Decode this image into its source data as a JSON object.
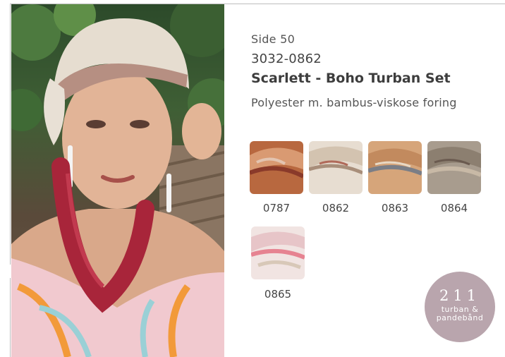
{
  "page": {
    "side": "Side 50",
    "article_code": "3032-0862",
    "title": "Scarlett - Boho Turban Set",
    "material": "Polyester m. bambus-viskose foring"
  },
  "swatches": [
    {
      "code": "0787"
    },
    {
      "code": "0862"
    },
    {
      "code": "0863"
    },
    {
      "code": "0864"
    },
    {
      "code": "0865"
    }
  ],
  "badge": {
    "number": "211",
    "line1": "turban &",
    "line2": "pandebånd"
  }
}
